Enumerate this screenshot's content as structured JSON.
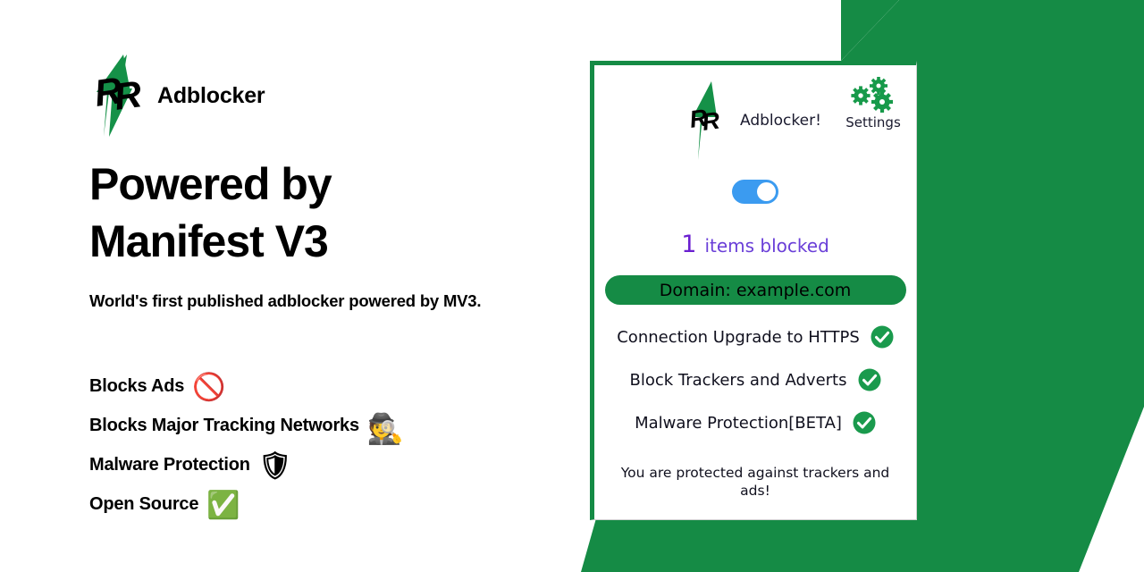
{
  "theme": {
    "brand_green": "#158b45",
    "toggle_blue": "#3b9bf0",
    "counter_purple": "#6a3fd8",
    "text_black": "#000000",
    "page_background": "#ffffff"
  },
  "left": {
    "brand_logo_icon": "rr-lightning-logo-icon",
    "brand_name": "Adblocker",
    "headline_line1": "Powered by",
    "headline_line2": "Manifest V3",
    "subheadline": "World's first published adblocker powered by MV3.",
    "features": [
      {
        "label": "Blocks Ads",
        "emoji": "🚫",
        "emoji_name": "no-ads-icon",
        "emoji_class": "em-ads"
      },
      {
        "label": "Blocks Major Tracking Networks",
        "emoji": "🕵",
        "emoji_name": "no-spy-icon",
        "emoji_class": "em-spy"
      },
      {
        "label": "Malware Protection",
        "emoji": "🛡",
        "emoji_name": "shield-check-icon",
        "emoji_class": "em-shield"
      },
      {
        "label": "Open Source",
        "emoji": "✅",
        "emoji_name": "green-check-icon",
        "emoji_class": "em-check"
      }
    ]
  },
  "popup": {
    "logo_icon": "rr-lightning-logo-icon",
    "title": "Adblocker!",
    "settings": {
      "icon": "gears-icon",
      "label": "Settings"
    },
    "toggle": {
      "name": "adblock-enabled-toggle",
      "state": "on"
    },
    "counter": {
      "count": "1",
      "label": "items blocked"
    },
    "domain": {
      "label": "Domain: example.com"
    },
    "checklist": [
      {
        "label": "Connection Upgrade to HTTPS",
        "checked": true
      },
      {
        "label": "Block Trackers and Adverts",
        "checked": true
      },
      {
        "label": "Malware Protection[BETA]",
        "checked": true
      }
    ],
    "footer": "You are protected against trackers and ads!"
  }
}
